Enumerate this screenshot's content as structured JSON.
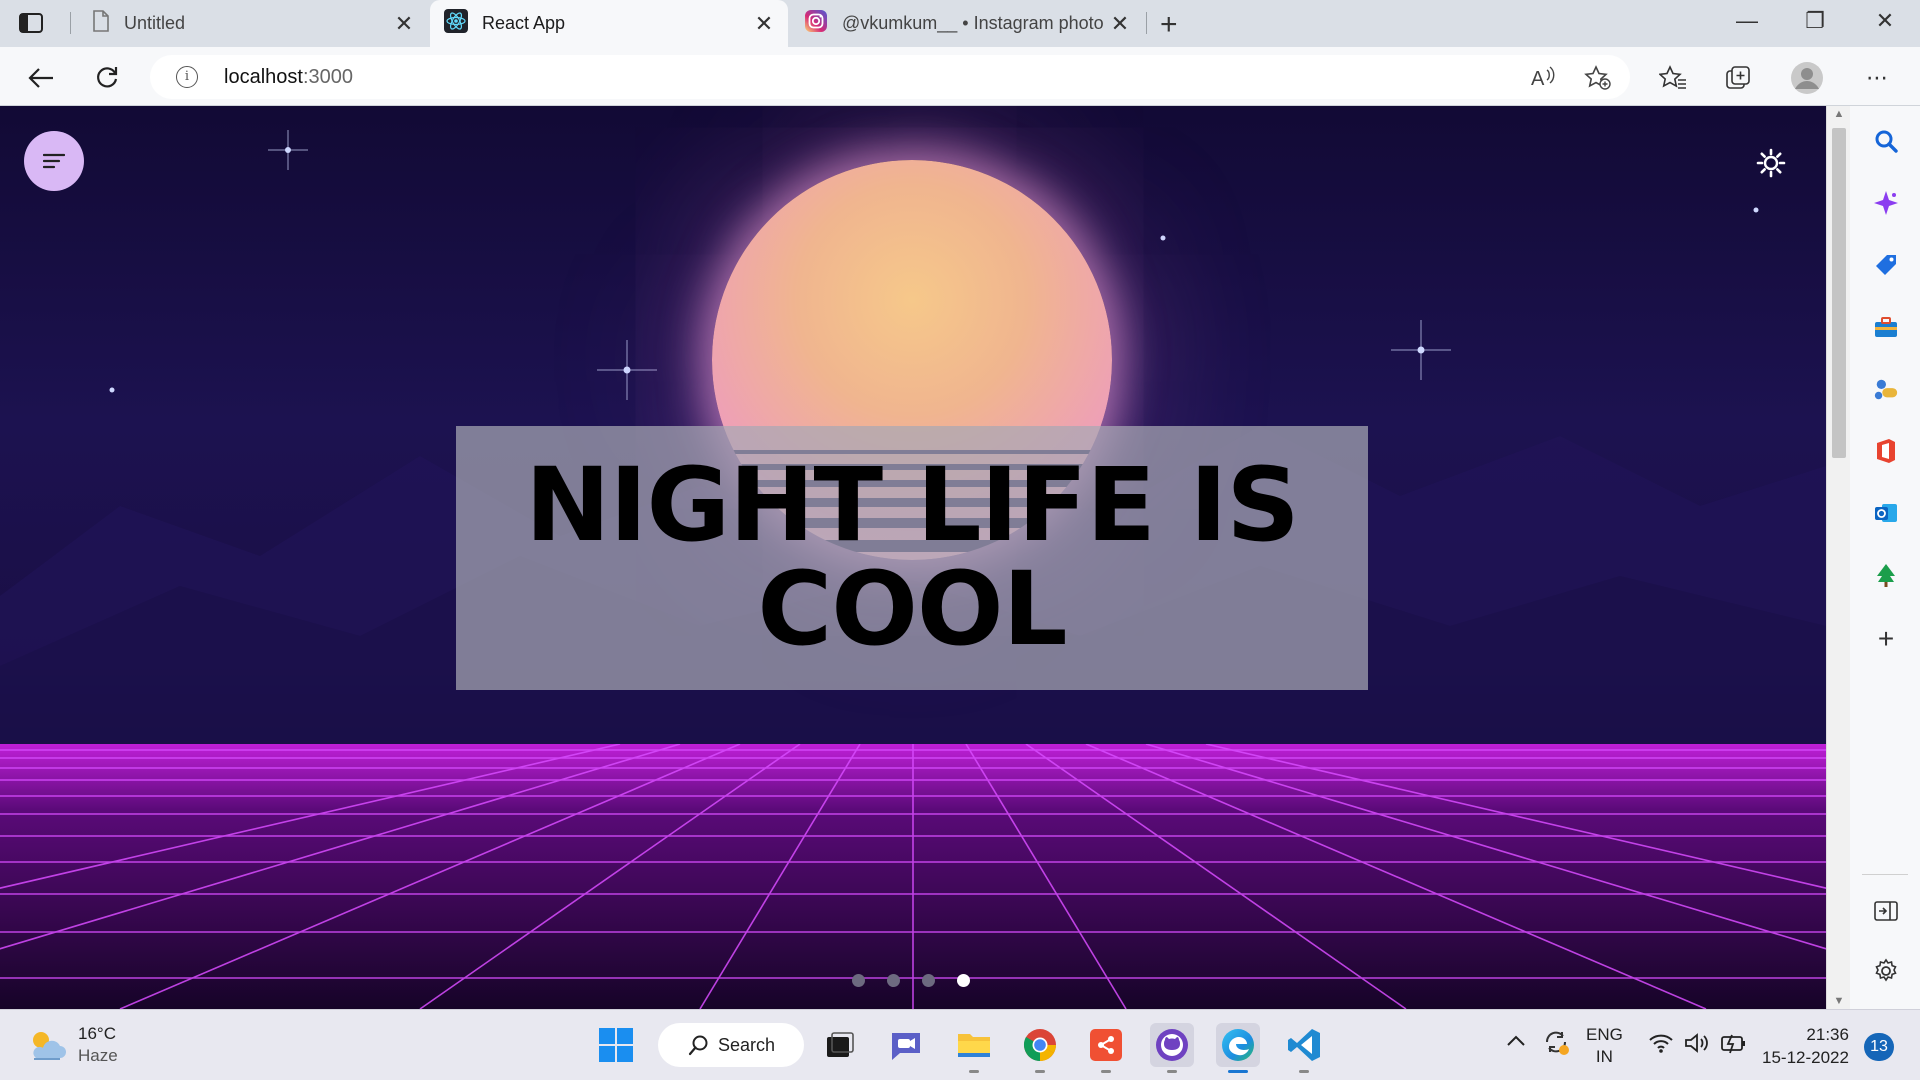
{
  "browser": {
    "tabs": [
      {
        "title": "Untitled",
        "close": "✕"
      },
      {
        "title": "React App",
        "close": "✕"
      },
      {
        "title": "@vkumkum__ • Instagram photo",
        "close": "✕"
      }
    ],
    "new_tab": "+",
    "window_controls": {
      "minimize": "—",
      "restore": "❐",
      "close": "✕"
    },
    "address": {
      "host": "localhost",
      "port": ":3000"
    }
  },
  "page": {
    "hero_line1": "NIGHT LIFE IS",
    "hero_line2": "COOL",
    "carousel": {
      "total": 4,
      "active_index": 3
    }
  },
  "sidebar": {
    "icons": [
      "search-icon",
      "copilot-icon",
      "shopping-icon",
      "tools-icon",
      "games-icon",
      "office-icon",
      "outlook-icon",
      "tree-icon",
      "add-icon",
      "split-screen-icon",
      "settings-icon"
    ]
  },
  "taskbar": {
    "weather": {
      "temp": "16°C",
      "condition": "Haze"
    },
    "search_label": "Search",
    "language": {
      "lang": "ENG",
      "region": "IN"
    },
    "clock": {
      "time": "21:36",
      "date": "15-12-2022"
    },
    "notifications": "13"
  }
}
